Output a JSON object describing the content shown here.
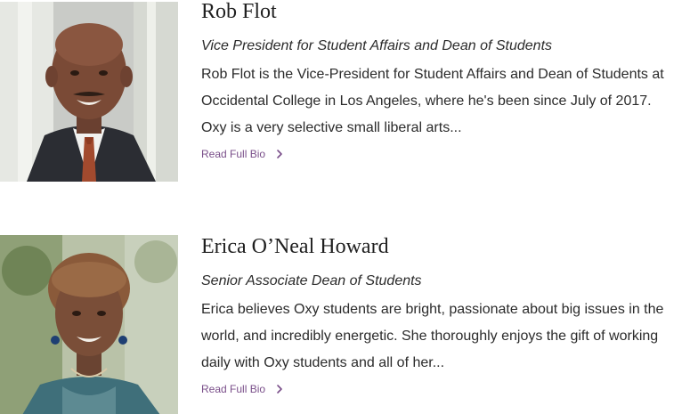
{
  "profiles": [
    {
      "name": "Rob Flot",
      "title": "Vice President for Student Affairs and Dean of Students",
      "bio": "Rob Flot is the Vice-President for Student Affairs and Dean of Students at Occidental College in Los Angeles, where he's been since July of 2017. Oxy is a very selective small liberal arts...",
      "link_label": "Read Full Bio",
      "link_icon": "chevron-right-icon"
    },
    {
      "name": "Erica O’Neal Howard",
      "title": "Senior Associate Dean of Students",
      "bio": "Erica believes Oxy students are bright, passionate about big issues in the world, and incredibly energetic. She thoroughly enjoys the gift of working daily with Oxy students and all of her...",
      "link_label": "Read Full Bio",
      "link_icon": "chevron-right-icon"
    }
  ],
  "colors": {
    "link": "#7a4f8a",
    "text": "#2b2b2b",
    "heading": "#1f1f1f"
  }
}
